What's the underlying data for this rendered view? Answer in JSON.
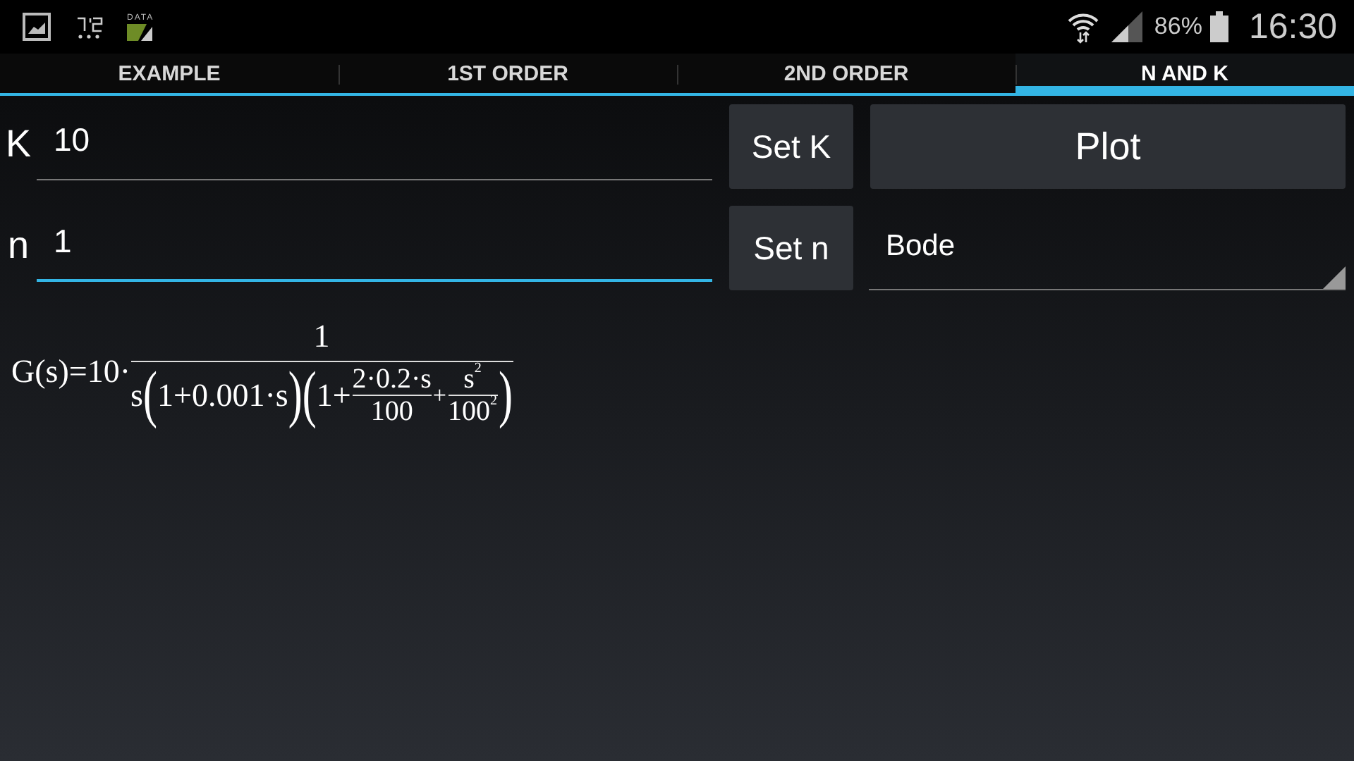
{
  "status_bar": {
    "data_label": "DATA",
    "battery": "86%",
    "time": "16:30"
  },
  "tabs": [
    {
      "label": "EXAMPLE",
      "selected": false
    },
    {
      "label": "1ST ORDER",
      "selected": false
    },
    {
      "label": "2ND ORDER",
      "selected": false
    },
    {
      "label": "N AND K",
      "selected": true
    }
  ],
  "rows": [
    {
      "label": "K",
      "field": {
        "value": "10",
        "focused": false
      },
      "button": "Set K",
      "side": {
        "kind": "button",
        "label": "Plot"
      }
    },
    {
      "label": "n",
      "field": {
        "value": "1",
        "focused": true
      },
      "button": "Set n",
      "side": {
        "kind": "dropdown",
        "value": "Bode"
      }
    }
  ],
  "formula": {
    "prefix": "G(s)=10·",
    "numerator": "1",
    "denominator": [
      {
        "kind": "text",
        "text": "s"
      },
      {
        "kind": "paren",
        "text": "("
      },
      {
        "kind": "text",
        "text": "1+0.001·s"
      },
      {
        "kind": "paren",
        "text": ")"
      },
      {
        "kind": "paren",
        "text": "("
      },
      {
        "kind": "text",
        "text": "1+"
      },
      {
        "kind": "frac",
        "numerator": "2·0.2·s",
        "denominator": "100"
      },
      {
        "kind": "small",
        "text": "+"
      },
      {
        "kind": "frac",
        "numerator": "s$^{2}$",
        "denominator": "100$^{2}$"
      },
      {
        "kind": "paren",
        "text": ")"
      }
    ]
  }
}
